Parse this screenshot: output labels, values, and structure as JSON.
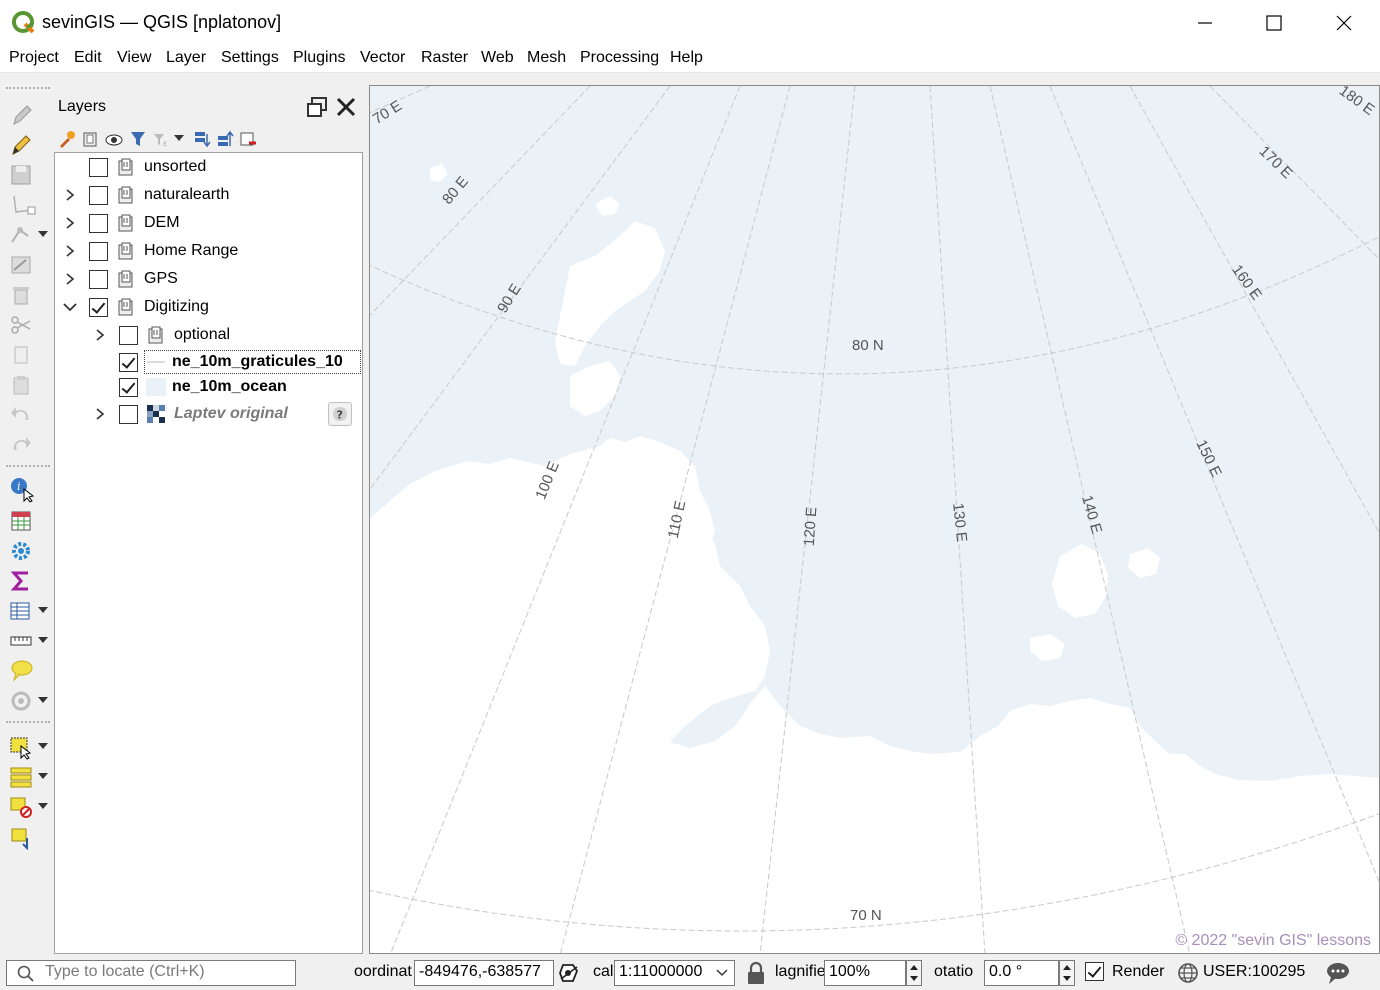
{
  "window": {
    "title": "sevinGIS — QGIS [nplatonov]"
  },
  "menu": [
    "Project",
    "Edit",
    "View",
    "Layer",
    "Settings",
    "Plugins",
    "Vector",
    "Raster",
    "Web",
    "Mesh",
    "Processing",
    "Help"
  ],
  "layers_panel": {
    "title": "Layers",
    "items": [
      {
        "label": "unsorted",
        "checked": false,
        "expandable": false,
        "indent": 0,
        "icon": "group-icon",
        "bold": false,
        "italic": false
      },
      {
        "label": "naturalearth",
        "checked": false,
        "expandable": true,
        "indent": 0,
        "icon": "group-icon",
        "bold": false,
        "italic": false
      },
      {
        "label": "DEM",
        "checked": false,
        "expandable": true,
        "indent": 0,
        "icon": "group-icon",
        "bold": false,
        "italic": false
      },
      {
        "label": "Home Range",
        "checked": false,
        "expandable": true,
        "indent": 0,
        "icon": "group-icon",
        "bold": false,
        "italic": false
      },
      {
        "label": "GPS",
        "checked": false,
        "expandable": true,
        "indent": 0,
        "icon": "group-icon",
        "bold": false,
        "italic": false
      },
      {
        "label": "Digitizing",
        "checked": true,
        "expandable": true,
        "expanded": true,
        "indent": 0,
        "icon": "group-icon",
        "bold": false,
        "italic": false
      },
      {
        "label": "optional",
        "checked": false,
        "expandable": true,
        "indent": 1,
        "icon": "group-icon",
        "bold": false,
        "italic": false
      },
      {
        "label": "ne_10m_graticules_10",
        "checked": true,
        "expandable": false,
        "indent": 1,
        "icon": "line-layer-icon",
        "bold": true,
        "italic": false,
        "selected": true
      },
      {
        "label": "ne_10m_ocean",
        "checked": true,
        "expandable": false,
        "indent": 1,
        "icon": "polygon-layer-icon",
        "bold": true,
        "italic": false
      },
      {
        "label": "Laptev original",
        "checked": false,
        "expandable": true,
        "indent": 1,
        "icon": "raster-layer-icon",
        "bold": true,
        "italic": true,
        "warning": true
      }
    ]
  },
  "map": {
    "ocean_color": "#eaf2f8",
    "land_color": "#ffffff",
    "graticule_color": "#c8c8c8",
    "labels": {
      "lon_70": "70 E",
      "lon_80": "80 E",
      "lon_90": "90 E",
      "lon_100": "100 E",
      "lon_110": "110 E",
      "lon_120": "120 E",
      "lon_130": "130 E",
      "lon_140": "140 E",
      "lon_150": "150 E",
      "lon_160": "160 E",
      "lon_170": "170 E",
      "lon_180": "180 E",
      "lat_80": "80 N",
      "lat_70": "70 N"
    },
    "copyright": "© 2022 \"sevin GIS\" lessons"
  },
  "statusbar": {
    "locator_placeholder": "Type to locate (Ctrl+K)",
    "coordinate_label": "oordinat",
    "coordinate_value": "-849476,-638577",
    "scale_label": "cal",
    "scale_value": "1:11000000",
    "magnifier_label": "lagnifie",
    "magnifier_value": "100%",
    "rotation_label": "otatio",
    "rotation_value": "0.0 °",
    "render_label": "Render",
    "render_checked": true,
    "crs_label": "USER:100295"
  }
}
